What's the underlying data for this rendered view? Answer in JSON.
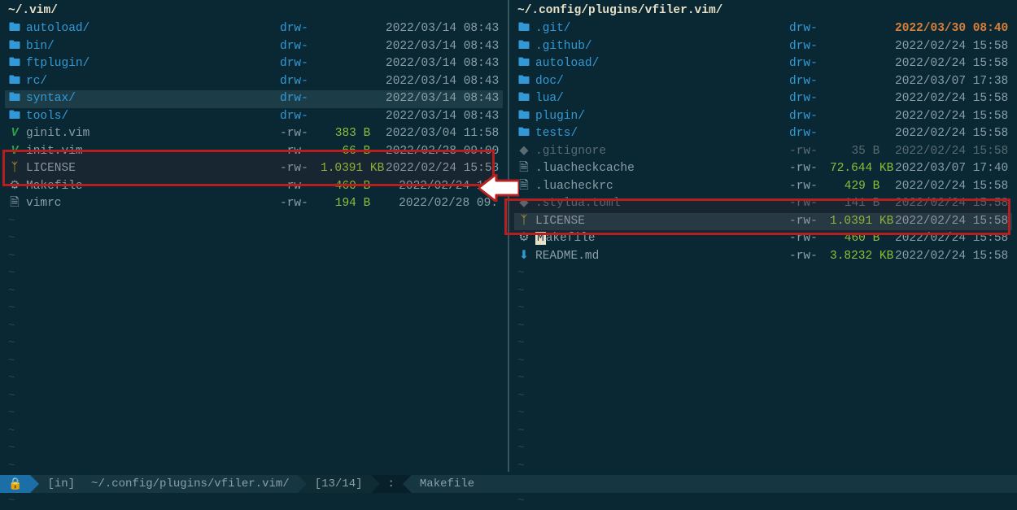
{
  "left": {
    "path": "~/.vim/",
    "items": [
      {
        "icon": "folder",
        "name": "autoload/",
        "perm": "drw-",
        "size": "",
        "date": "2022/03/14 08:43",
        "style": "dir"
      },
      {
        "icon": "folder",
        "name": "bin/",
        "perm": "drw-",
        "size": "",
        "date": "2022/03/14 08:43",
        "style": "dir"
      },
      {
        "icon": "folder",
        "name": "ftplugin/",
        "perm": "drw-",
        "size": "",
        "date": "2022/03/14 08:43",
        "style": "dir"
      },
      {
        "icon": "folder",
        "name": "rc/",
        "perm": "drw-",
        "size": "",
        "date": "2022/03/14 08:43",
        "style": "dir"
      },
      {
        "icon": "folder",
        "name": "syntax/",
        "perm": "drw-",
        "size": "",
        "date": "2022/03/14 08:43",
        "style": "dir",
        "selected": true
      },
      {
        "icon": "folder",
        "name": "tools/",
        "perm": "drw-",
        "size": "",
        "date": "2022/03/14 08:43",
        "style": "dir"
      },
      {
        "icon": "vim",
        "name": "ginit.vim",
        "perm": "-rw-",
        "size": "383 B ",
        "date": "2022/03/04 11:58",
        "style": "file"
      },
      {
        "icon": "vim",
        "name": "init.vim",
        "perm": "-rw-",
        "size": "66 B ",
        "date": "2022/02/28 09:00",
        "style": "file"
      },
      {
        "icon": "key",
        "name": "LICENSE",
        "perm": "-rw-",
        "size": "1.0391 KB",
        "date": "2022/02/24 15:58",
        "style": "file"
      },
      {
        "icon": "gear",
        "name": "Makefile",
        "perm": "-rw-",
        "size": "460 B ",
        "date": "2022/02/24 15:",
        "style": "file"
      },
      {
        "icon": "doc",
        "name": "vimrc",
        "perm": "-rw-",
        "size": "194 B ",
        "date": "2022/02/28 09.",
        "style": "file"
      }
    ]
  },
  "right": {
    "path": "~/.config/plugins/vfiler.vim/",
    "items": [
      {
        "icon": "folder",
        "name": ".git/",
        "perm": "drw-",
        "size": "",
        "date": "2022/03/30 08:40",
        "style": "dir",
        "hotdate": true
      },
      {
        "icon": "folder",
        "name": ".github/",
        "perm": "drw-",
        "size": "",
        "date": "2022/02/24 15:58",
        "style": "dir"
      },
      {
        "icon": "folder",
        "name": "autoload/",
        "perm": "drw-",
        "size": "",
        "date": "2022/02/24 15:58",
        "style": "dir"
      },
      {
        "icon": "folder",
        "name": "doc/",
        "perm": "drw-",
        "size": "",
        "date": "2022/03/07 17:38",
        "style": "dir"
      },
      {
        "icon": "folder",
        "name": "lua/",
        "perm": "drw-",
        "size": "",
        "date": "2022/02/24 15:58",
        "style": "dir"
      },
      {
        "icon": "folder",
        "name": "plugin/",
        "perm": "drw-",
        "size": "",
        "date": "2022/02/24 15:58",
        "style": "dir"
      },
      {
        "icon": "folder",
        "name": "tests/",
        "perm": "drw-",
        "size": "",
        "date": "2022/02/24 15:58",
        "style": "dir"
      },
      {
        "icon": "dim",
        "name": ".gitignore",
        "perm": "-rw-",
        "size": "35 B ",
        "date": "2022/02/24 15:58",
        "style": "dim"
      },
      {
        "icon": "doc",
        "name": ".luacheckcache",
        "perm": "-rw-",
        "size": "72.644 KB",
        "date": "2022/03/07 17:40",
        "style": "file"
      },
      {
        "icon": "doc",
        "name": ".luacheckrc",
        "perm": "-rw-",
        "size": "429 B ",
        "date": "2022/02/24 15:58",
        "style": "file"
      },
      {
        "icon": "dim",
        "name": ".stylua.toml",
        "perm": "-rw-",
        "size": "141 B ",
        "date": "2022/02/24 15:58",
        "style": "dim"
      },
      {
        "icon": "key",
        "name": "LICENSE",
        "perm": "-rw-",
        "size": "1.0391 KB",
        "date": "2022/02/24 15:58",
        "style": "file",
        "selected": true
      },
      {
        "icon": "gear",
        "name": "Makefile",
        "perm": "-rw-",
        "size": "460 B ",
        "date": "2022/02/24 15:58",
        "style": "file",
        "cursor": true
      },
      {
        "icon": "md",
        "name": "README.md",
        "perm": "-rw-",
        "size": "3.8232 KB",
        "date": "2022/02/24 15:58",
        "style": "file"
      }
    ]
  },
  "status": {
    "lock": "🔒",
    "tag": "[in]",
    "path": "~/.config/plugins/vfiler.vim/",
    "pos": "[13/14]",
    "sep": ":",
    "file": "Makefile"
  },
  "glyph": {
    "folder": "🖿",
    "vim": "V",
    "key": "ᛉ",
    "gear": "⚙",
    "doc": "🗎",
    "dim": "◆",
    "md": "⬇"
  }
}
